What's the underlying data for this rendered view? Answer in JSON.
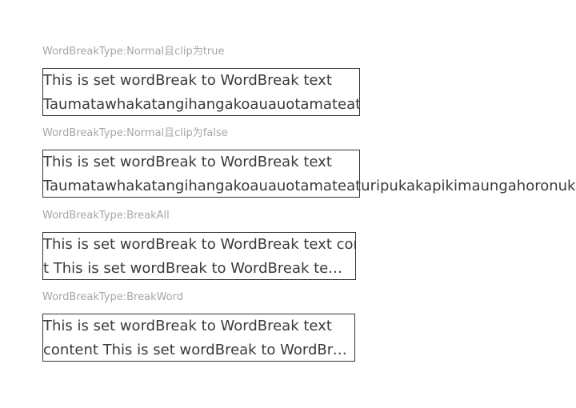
{
  "sections": [
    {
      "caption": "WordBreakType:Normal且clip为true",
      "line1": "This is set wordBreak to WordBreak text",
      "line2": "Taumatawhakatangihangakoauauotamateaturipukakapikimaungahoronukupokaiwhenuakitanatahu"
    },
    {
      "caption": "WordBreakType:Normal且clip为false",
      "line1": "This is set wordBreak to WordBreak text",
      "line2": "Taumatawhakatangihangakoauauotamateaturipukakapikimaungahoronukupokaiwhenuakitanatahu"
    },
    {
      "caption": "WordBreakType:BreakAll",
      "line1": "This is set wordBreak to WordBreak text conten",
      "line2": "t This is set wordBreak to WordBreak text content"
    },
    {
      "caption": "WordBreakType:BreakWord",
      "line1": "This is set wordBreak to WordBreak text",
      "line2": "content This is set wordBreak to WordBreak text content"
    }
  ]
}
